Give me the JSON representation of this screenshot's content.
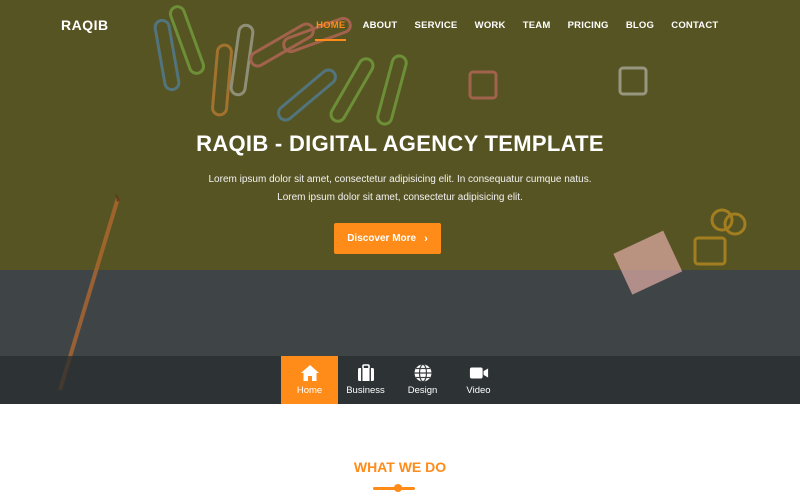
{
  "header": {
    "brand": "RAQIB",
    "nav": [
      {
        "label": "HOME",
        "active": true
      },
      {
        "label": "ABOUT",
        "active": false
      },
      {
        "label": "SERVICE",
        "active": false
      },
      {
        "label": "WORK",
        "active": false
      },
      {
        "label": "TEAM",
        "active": false
      },
      {
        "label": "PRICING",
        "active": false
      },
      {
        "label": "BLOG",
        "active": false
      },
      {
        "label": "CONTACT",
        "active": false
      }
    ]
  },
  "hero": {
    "title": "RAQIB - DIGITAL AGENCY TEMPLATE",
    "text_line1": "Lorem ipsum dolor sit amet, consectetur adipisicing elit. In consequatur cumque natus.",
    "text_line2": "Lorem ipsum dolor sit amet, consectetur adipisicing elit.",
    "cta_label": "Discover More",
    "cta_icon": "chevron-right-icon"
  },
  "tabs": [
    {
      "label": "Home",
      "icon": "home-icon",
      "active": true
    },
    {
      "label": "Business",
      "icon": "briefcase-icon",
      "active": false
    },
    {
      "label": "Design",
      "icon": "globe-icon",
      "active": false
    },
    {
      "label": "Video",
      "icon": "video-camera-icon",
      "active": false
    }
  ],
  "section": {
    "title": "WHAT WE DO"
  },
  "colors": {
    "accent": "#ff8b19",
    "hero_overlay": "#575423",
    "tabbar": "#282c2e"
  }
}
